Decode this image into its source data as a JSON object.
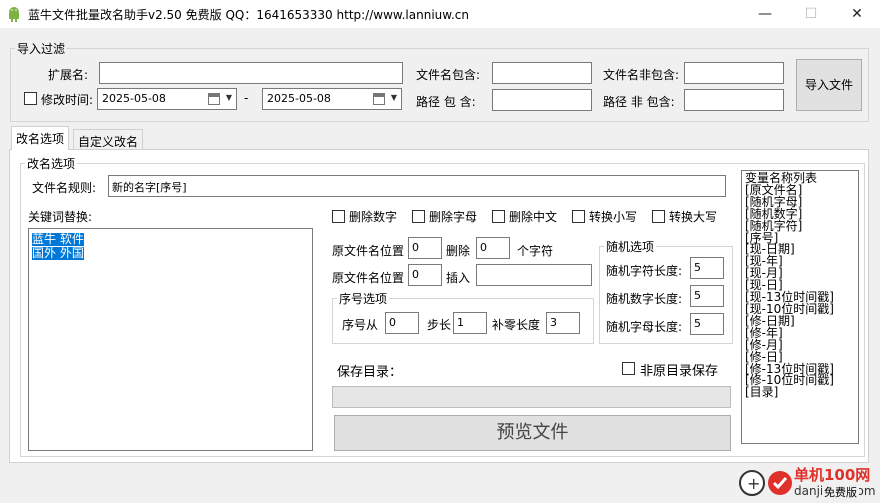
{
  "window": {
    "title": "蓝牛文件批量改名助手v2.50 免费版 QQ：1641653330  http://www.lanniuw.cn",
    "minimize": "—",
    "maximize": "☐",
    "close": "✕"
  },
  "import_filter": {
    "legend": "导入过滤",
    "ext_label": "扩展名:",
    "ext_value": "",
    "mtime_label": "修改时间:",
    "mtime_checked": false,
    "date_from": "2025-05-08",
    "date_sep": "-",
    "date_to": "2025-05-08",
    "name_contains_label": "文件名包含:",
    "name_contains_value": "",
    "path_contains_label": "路径 包 含:",
    "path_contains_value": "",
    "name_excludes_label": "文件名非包含:",
    "name_excludes_value": "",
    "path_excludes_label": "路径 非 包含:",
    "path_excludes_value": "",
    "import_button": "导入文件"
  },
  "tabs": [
    {
      "label": "改名选项",
      "active": true
    },
    {
      "label": "自定义改名",
      "active": false
    }
  ],
  "rename": {
    "legend": "改名选项",
    "rule_label": "文件名规则:",
    "rule_value": "新的名字[序号]",
    "keyword_label": "关键词替换:",
    "keyword_lines": [
      "蓝牛 软件",
      "国外 外国"
    ],
    "options": [
      {
        "label": "删除数字",
        "checked": false
      },
      {
        "label": "删除字母",
        "checked": false
      },
      {
        "label": "删除中文",
        "checked": false
      },
      {
        "label": "转换小写",
        "checked": false
      },
      {
        "label": "转换大写",
        "checked": false
      }
    ],
    "pos1_label": "原文件名位置",
    "pos1_value": "0",
    "delete_label": "删除",
    "delete_value": "0",
    "chars_label": "个字符",
    "pos2_label": "原文件名位置",
    "pos2_value": "0",
    "insert_label": "插入",
    "insert_value": "",
    "seq": {
      "legend": "序号选项",
      "from_label": "序号从",
      "from_value": "0",
      "step_label": "步长",
      "step_value": "1",
      "pad_label": "补零长度",
      "pad_value": "3"
    },
    "random": {
      "legend": "随机选项",
      "char_len_label": "随机字符长度:",
      "char_len_value": "5",
      "digit_len_label": "随机数字长度:",
      "digit_len_value": "5",
      "letter_len_label": "随机字母长度:",
      "letter_len_value": "5"
    },
    "save_dir_label": "保存目录：",
    "non_origin_label": "非原目录保存",
    "non_origin_checked": false,
    "preview_button": "预览文件",
    "variables": [
      "变量名称列表",
      "[原文件名]",
      "[随机字母]",
      "[随机数字]",
      "[随机字符]",
      "[序号]",
      "[现-日期]",
      "[现-年]",
      "[现-月]",
      "[现-日]",
      "[现-13位时间戳]",
      "[现-10位时间戳]",
      "[修-日期]",
      "[修-年]",
      "[修-月]",
      "[修-日]",
      "[修-13位时间戳]",
      "[修-10位时间戳]",
      "[目录]"
    ]
  },
  "watermark": {
    "site": "单机100网",
    "domain": "danji100.com",
    "edition": "免费版"
  },
  "colors": {
    "selection": "#0078d7",
    "watermark_red": "#e0302a"
  }
}
